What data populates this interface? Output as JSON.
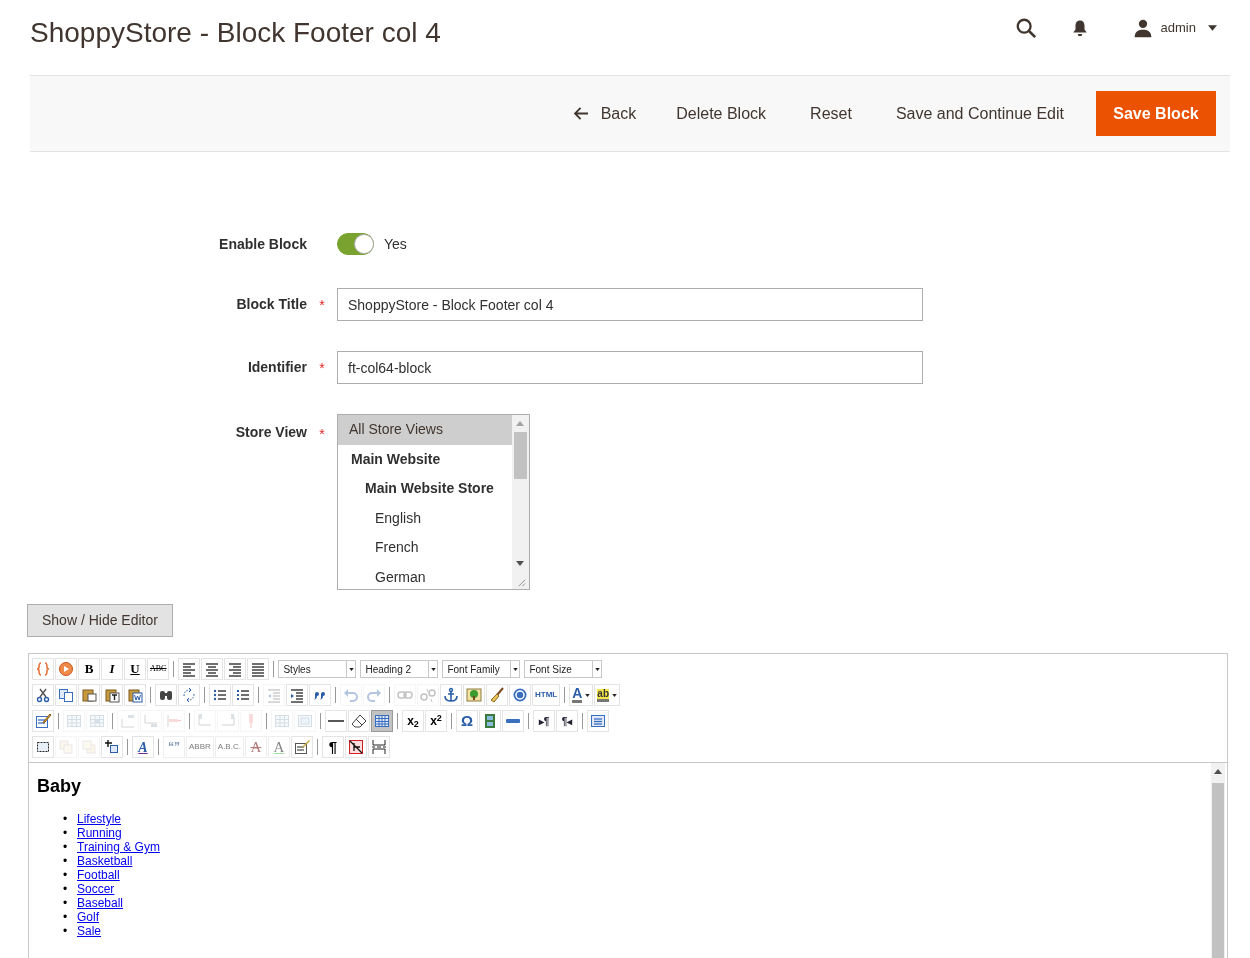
{
  "header": {
    "title": "ShoppyStore - Block Footer col 4",
    "user": "admin"
  },
  "actions": [
    {
      "kind": "back",
      "label": "Back"
    },
    {
      "kind": "plain",
      "label": "Delete Block"
    },
    {
      "kind": "plain",
      "label": "Reset"
    },
    {
      "kind": "plain",
      "label": "Save and Continue Edit"
    },
    {
      "kind": "primary",
      "label": "Save Block"
    }
  ],
  "form": {
    "enable_block": {
      "label": "Enable Block",
      "on": true,
      "value_label": "Yes"
    },
    "fields": [
      {
        "label": "Block Title",
        "required_mark": "*",
        "value": "ShoppyStore - Block Footer col 4"
      },
      {
        "label": "Identifier",
        "required_mark": "*",
        "value": "ft-col64-block"
      }
    ],
    "store_view": {
      "label": "Store View",
      "required_mark": "*",
      "options": [
        {
          "label": "All Store Views",
          "selected": true
        },
        {
          "label": "Main Website",
          "selected": false,
          "children": [
            {
              "label": "Main Website Store",
              "selected": false,
              "children": [
                {
                  "label": "English",
                  "selected": false
                },
                {
                  "label": "French",
                  "selected": false
                },
                {
                  "label": "German",
                  "selected": false
                }
              ]
            }
          ]
        }
      ]
    }
  },
  "editor_toggle": "Show / Hide Editor",
  "editor": {
    "toolbar": [
      [
        {
          "kind": "widget",
          "disabled": false,
          "active": false
        },
        {
          "kind": "image",
          "disabled": false,
          "active": false
        },
        {
          "kind": "bold",
          "label": "B",
          "disabled": false,
          "active": false
        },
        {
          "kind": "italic",
          "label": "I",
          "disabled": false,
          "active": false
        },
        {
          "kind": "underline",
          "label": "U",
          "disabled": false,
          "active": false
        },
        {
          "kind": "strike",
          "label": "ABC",
          "disabled": false,
          "active": false
        },
        {
          "kind": "sep"
        },
        {
          "kind": "alignleft",
          "disabled": false,
          "active": false
        },
        {
          "kind": "aligncenter",
          "disabled": false,
          "active": false
        },
        {
          "kind": "alignright",
          "disabled": false,
          "active": false
        },
        {
          "kind": "justify",
          "disabled": false,
          "active": false
        },
        {
          "kind": "sep"
        },
        {
          "kind": "select",
          "value": "Styles"
        },
        {
          "kind": "select",
          "value": "Heading 2"
        },
        {
          "kind": "select",
          "value": "Font Family"
        },
        {
          "kind": "select",
          "value": "Font Size"
        }
      ],
      [
        {
          "kind": "cut",
          "disabled": false,
          "active": false
        },
        {
          "kind": "copy",
          "disabled": false,
          "active": false
        },
        {
          "kind": "paste",
          "disabled": false,
          "active": false
        },
        {
          "kind": "pastetext",
          "disabled": false,
          "active": false
        },
        {
          "kind": "pasteword",
          "disabled": false,
          "active": false
        },
        {
          "kind": "sep"
        },
        {
          "kind": "find",
          "disabled": false,
          "active": false
        },
        {
          "kind": "replace",
          "disabled": false,
          "active": false
        },
        {
          "kind": "sep"
        },
        {
          "kind": "bullets",
          "disabled": false,
          "active": false
        },
        {
          "kind": "numbers",
          "disabled": false,
          "active": false
        },
        {
          "kind": "sep"
        },
        {
          "kind": "outdent",
          "disabled": true,
          "active": false
        },
        {
          "kind": "indent",
          "disabled": false,
          "active": false
        },
        {
          "kind": "quote",
          "disabled": false,
          "active": false
        },
        {
          "kind": "sep"
        },
        {
          "kind": "undo",
          "disabled": true,
          "active": false
        },
        {
          "kind": "redo",
          "disabled": true,
          "active": false
        },
        {
          "kind": "sep"
        },
        {
          "kind": "link",
          "disabled": true,
          "active": false
        },
        {
          "kind": "unlink",
          "disabled": true,
          "active": false
        },
        {
          "kind": "anchor",
          "disabled": false,
          "active": false
        },
        {
          "kind": "picture",
          "disabled": false,
          "active": false
        },
        {
          "kind": "cleanup",
          "disabled": false,
          "active": false
        },
        {
          "kind": "help",
          "disabled": false,
          "active": false
        },
        {
          "kind": "html",
          "label": "HTML",
          "disabled": false,
          "active": false
        },
        {
          "kind": "sep"
        },
        {
          "kind": "forecolor",
          "label": "A",
          "disabled": false,
          "active": false
        },
        {
          "kind": "backcolor",
          "label": "ab",
          "disabled": false,
          "active": false
        }
      ],
      [
        {
          "kind": "editform",
          "disabled": false,
          "active": false
        },
        {
          "kind": "sep"
        },
        {
          "kind": "rowprops",
          "disabled": true,
          "active": false
        },
        {
          "kind": "cellprops",
          "disabled": true,
          "active": false
        },
        {
          "kind": "sep"
        },
        {
          "kind": "rowbefore",
          "disabled": true,
          "active": false
        },
        {
          "kind": "rowafter",
          "disabled": true,
          "active": false
        },
        {
          "kind": "rowdelete",
          "disabled": true,
          "active": false
        },
        {
          "kind": "sep"
        },
        {
          "kind": "colbefore",
          "disabled": true,
          "active": false
        },
        {
          "kind": "colafter",
          "disabled": true,
          "active": false
        },
        {
          "kind": "coldelete",
          "disabled": true,
          "active": false
        },
        {
          "kind": "sep"
        },
        {
          "kind": "split",
          "disabled": true,
          "active": false
        },
        {
          "kind": "merge",
          "disabled": true,
          "active": false
        },
        {
          "kind": "sep"
        },
        {
          "kind": "hr",
          "disabled": false,
          "active": false
        },
        {
          "kind": "eraser",
          "disabled": false,
          "active": false
        },
        {
          "kind": "table",
          "disabled": false,
          "active": true
        },
        {
          "kind": "sep"
        },
        {
          "kind": "sub",
          "label": "x$_{2}$",
          "disabled": false,
          "active": false
        },
        {
          "kind": "sup",
          "label": "x$^{2}$",
          "disabled": false,
          "active": false
        },
        {
          "kind": "sep"
        },
        {
          "kind": "charmap",
          "label": "Ω",
          "disabled": false,
          "active": false
        },
        {
          "kind": "media",
          "disabled": false,
          "active": false
        },
        {
          "kind": "rule",
          "disabled": false,
          "active": false
        },
        {
          "kind": "sep"
        },
        {
          "kind": "ltr",
          "label": "▸¶",
          "disabled": false,
          "active": false
        },
        {
          "kind": "rtl",
          "label": "¶◂",
          "disabled": false,
          "active": false
        },
        {
          "kind": "sep"
        },
        {
          "kind": "fullscreen",
          "disabled": false,
          "active": false
        }
      ],
      [
        {
          "kind": "frame",
          "disabled": false,
          "active": false
        },
        {
          "kind": "forward",
          "disabled": true,
          "active": false
        },
        {
          "kind": "backward",
          "disabled": true,
          "active": false
        },
        {
          "kind": "absolute",
          "disabled": false,
          "active": false
        },
        {
          "kind": "sep"
        },
        {
          "kind": "styleprops",
          "label": "A",
          "disabled": false,
          "active": false
        },
        {
          "kind": "sep"
        },
        {
          "kind": "cite",
          "label": "“”",
          "disabled": true,
          "active": false
        },
        {
          "kind": "abbr",
          "label": "ABBR",
          "disabled": true,
          "active": false
        },
        {
          "kind": "acronym",
          "label": "A.B.C.",
          "disabled": true,
          "active": false
        },
        {
          "kind": "del",
          "label": "A",
          "disabled": true,
          "active": false
        },
        {
          "kind": "ins",
          "label": "A",
          "disabled": true,
          "active": false
        },
        {
          "kind": "attribs",
          "disabled": false,
          "active": false
        },
        {
          "kind": "sep"
        },
        {
          "kind": "visualchars",
          "label": "¶",
          "disabled": false,
          "active": false
        },
        {
          "kind": "nonbreaking",
          "disabled": false,
          "active": false
        },
        {
          "kind": "pagebreak",
          "disabled": false,
          "active": false
        }
      ]
    ],
    "content": {
      "heading": "Baby",
      "links": [
        {
          "marker": "•",
          "label": "Lifestyle"
        },
        {
          "marker": "•",
          "label": "Running"
        },
        {
          "marker": "•",
          "label": "Training & Gym"
        },
        {
          "marker": "•",
          "label": "Basketball"
        },
        {
          "marker": "•",
          "label": "Football"
        },
        {
          "marker": "•",
          "label": "Soccer"
        },
        {
          "marker": "•",
          "label": "Baseball"
        },
        {
          "marker": "•",
          "label": "Golf"
        },
        {
          "marker": "•",
          "label": "Sale"
        }
      ]
    }
  }
}
